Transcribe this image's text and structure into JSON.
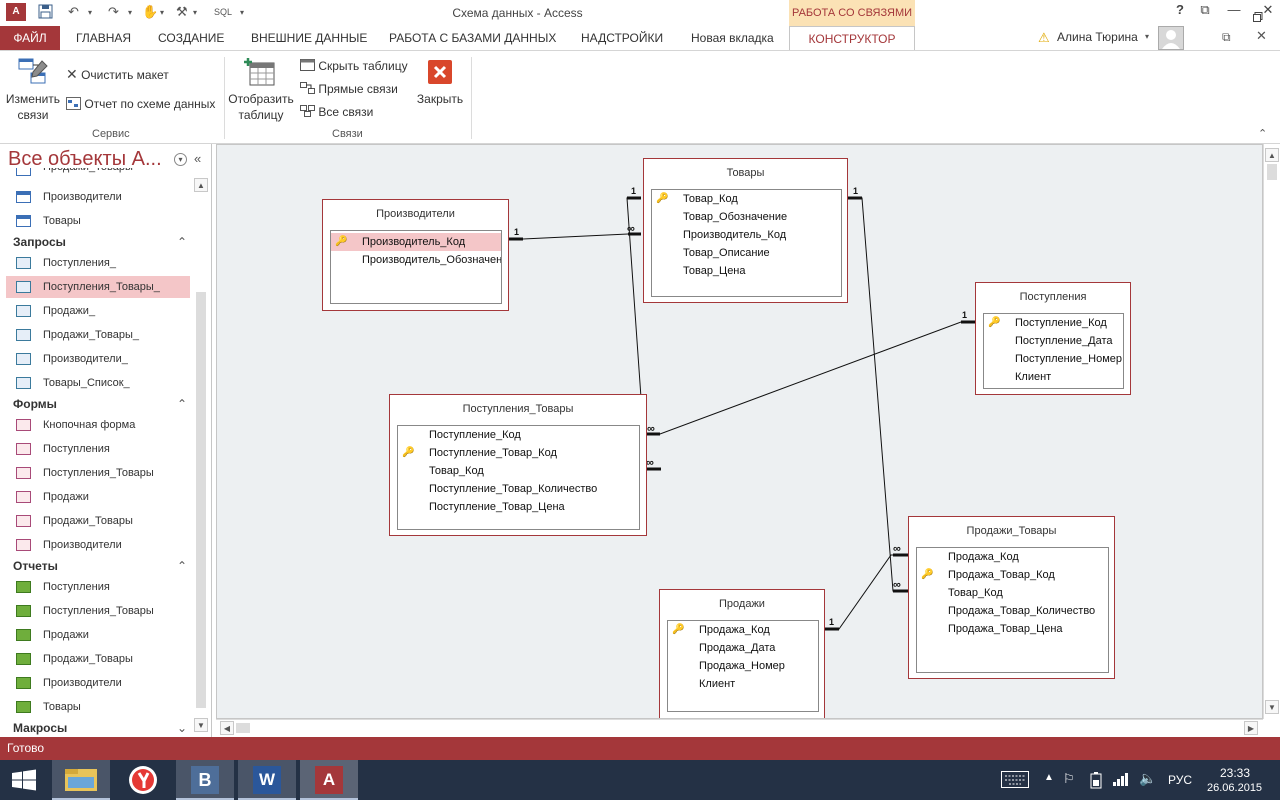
{
  "window": {
    "title": "Схема данных - Access",
    "app_icon": "A",
    "sql_label": "SQL",
    "context_tab": "РАБОТА СО СВЯЗЯМИ",
    "help": "?",
    "controls": [
      "—",
      "⧉",
      "✕"
    ]
  },
  "ribbon_tabs": {
    "file": "ФАЙЛ",
    "items": [
      "ГЛАВНАЯ",
      "СОЗДАНИЕ",
      "ВНЕШНИЕ ДАННЫЕ",
      "РАБОТА С БАЗАМИ ДАННЫХ",
      "НАДСТРОЙКИ",
      "Новая вкладка"
    ],
    "active": "КОНСТРУКТОР",
    "user": "Алина Тюрина"
  },
  "ribbon": {
    "edit_relations_line1": "Изменить",
    "edit_relations_line2": "связи",
    "clear_layout": "Очистить макет",
    "relationship_report": "Отчет по схеме данных",
    "group_service": "Сервис",
    "show_table_line1": "Отобразить",
    "show_table_line2": "таблицу",
    "hide_table": "Скрыть таблицу",
    "direct_relationships": "Прямые связи",
    "all_relationships": "Все связи",
    "close": "Закрыть",
    "group_relations": "Связи"
  },
  "nav": {
    "title": "Все объекты A...",
    "partial_item": "Продажи_Товары",
    "tables": [
      "Производители",
      "Товары"
    ],
    "groups": {
      "queries": "Запросы",
      "forms": "Формы",
      "reports": "Отчеты",
      "macros": "Макросы"
    },
    "queries": [
      "Поступления_",
      "Поступления_Товары_",
      "Продажи_",
      "Продажи_Товары_",
      "Производители_",
      "Товары_Список_"
    ],
    "forms": [
      "Кнопочная форма",
      "Поступления",
      "Поступления_Товары",
      "Продажи",
      "Продажи_Товары",
      "Производители"
    ],
    "reports": [
      "Поступления",
      "Поступления_Товары",
      "Продажи",
      "Продажи_Товары",
      "Производители",
      "Товары"
    ],
    "selected_item": "Поступления_Товары_"
  },
  "diagram": {
    "tables": [
      {
        "name": "Производители",
        "fields": [
          "Производитель_Код",
          "Производитель_Обозначение"
        ],
        "keys": [
          0
        ],
        "highlighted": 0
      },
      {
        "name": "Товары",
        "fields": [
          "Товар_Код",
          "Товар_Обозначение",
          "Производитель_Код",
          "Товар_Описание",
          "Товар_Цена"
        ],
        "keys": [
          0
        ]
      },
      {
        "name": "Поступления",
        "fields": [
          "Поступление_Код",
          "Поступление_Дата",
          "Поступление_Номер",
          "Клиент"
        ],
        "keys": [
          0
        ]
      },
      {
        "name": "Поступления_Товары",
        "fields": [
          "Поступление_Код",
          "Поступление_Товар_Код",
          "Товар_Код",
          "Поступление_Товар_Количество",
          "Поступление_Товар_Цена"
        ],
        "keys": [
          1
        ]
      },
      {
        "name": "Продажи_Товары",
        "fields": [
          "Продажа_Код",
          "Продажа_Товар_Код",
          "Товар_Код",
          "Продажа_Товар_Количество",
          "Продажа_Товар_Цена"
        ],
        "keys": [
          1
        ]
      },
      {
        "name": "Продажи",
        "fields": [
          "Продажа_Код",
          "Продажа_Дата",
          "Продажа_Номер",
          "Клиент"
        ],
        "keys": [
          0
        ]
      }
    ],
    "one_label": "1",
    "many_label": "∞"
  },
  "status": {
    "text": "Готово"
  },
  "taskbar": {
    "lang": "РУС",
    "time": "23:33",
    "date": "26.06.2015",
    "vk_label": "В",
    "word_label": "W",
    "access_label": "A"
  }
}
